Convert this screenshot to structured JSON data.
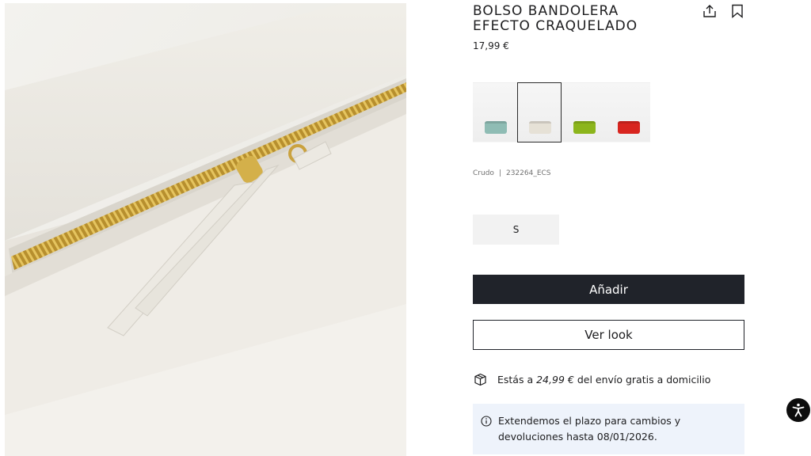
{
  "product": {
    "title": "BOLSO BANDOLERA EFECTO CRAQUELADO",
    "price": "17,99 €",
    "color_name": "Crudo",
    "separator": "|",
    "reference": "232264_ECS"
  },
  "swatches": [
    {
      "name": "aqua",
      "color": "#8fbcb4",
      "selected": false
    },
    {
      "name": "crudo",
      "color": "#e6e1d6",
      "selected": true
    },
    {
      "name": "lime",
      "color": "#8cb51c",
      "selected": false
    },
    {
      "name": "red",
      "color": "#d8251f",
      "selected": false
    }
  ],
  "sizes": [
    {
      "label": "S"
    }
  ],
  "actions": {
    "add_label": "Añadir",
    "look_label": "Ver look"
  },
  "shipping": {
    "prefix": "Estás a",
    "amount": "24,99 €",
    "suffix": "del envío gratis a domicilio"
  },
  "notice": {
    "text": "Extendemos el plazo para cambios y devoluciones hasta 08/01/2026."
  },
  "icons": {
    "share": "share-icon",
    "bookmark": "bookmark-icon",
    "shipping": "box-icon",
    "info": "info-icon",
    "accessibility": "accessibility-icon"
  },
  "colors": {
    "primary_button": "#20232a",
    "notice_background": "#eef3fb",
    "accessibility_button": "#0d0d0d"
  }
}
